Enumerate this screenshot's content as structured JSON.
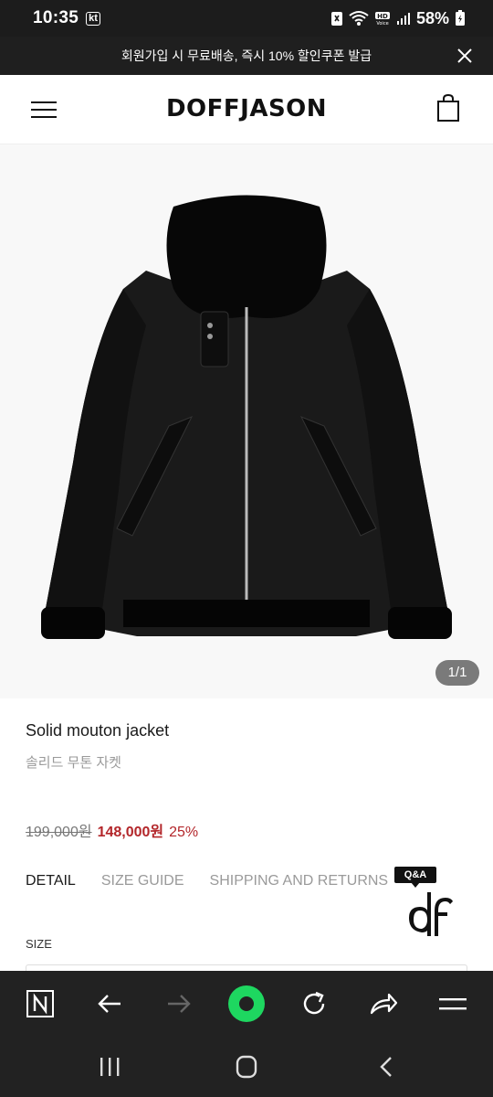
{
  "status_bar": {
    "time": "10:35",
    "carrier": "kt",
    "battery_percent": "58%",
    "icons": [
      "nfc-icon",
      "wifi-icon",
      "hd-voice-icon",
      "signal-icon",
      "battery-icon"
    ]
  },
  "promo_banner": {
    "text": "회원가입 시 무료배송, 즉시 10% 할인쿠폰 발급",
    "close_icon": "close-icon"
  },
  "header": {
    "logo": "DOFFJASON",
    "menu_icon": "hamburger-menu-icon",
    "cart_icon": "shopping-bag-icon"
  },
  "gallery": {
    "image_counter": "1/1",
    "background": "#f8f8f8"
  },
  "product": {
    "name_en": "Solid mouton jacket",
    "name_ko": "솔리드 무톤 자켓",
    "original_price": "199,000원",
    "sale_price": "148,000원",
    "discount": "25%"
  },
  "tabs": [
    {
      "label": "DETAIL",
      "active": true
    },
    {
      "label": "SIZE GUIDE",
      "active": false
    },
    {
      "label": "SHIPPING AND RETURNS",
      "active": false
    }
  ],
  "qa_badge": {
    "label": "Q&A"
  },
  "options": {
    "size_label": "SIZE"
  },
  "browser_toolbar": {
    "icons": [
      "naver-home-icon",
      "back-arrow-icon",
      "forward-arrow-icon",
      "green-dot-icon",
      "refresh-icon",
      "share-icon",
      "menu-icon"
    ]
  },
  "colors": {
    "accent_red": "#b3262a",
    "dark_bar": "#222222",
    "green": "#1ed760"
  }
}
